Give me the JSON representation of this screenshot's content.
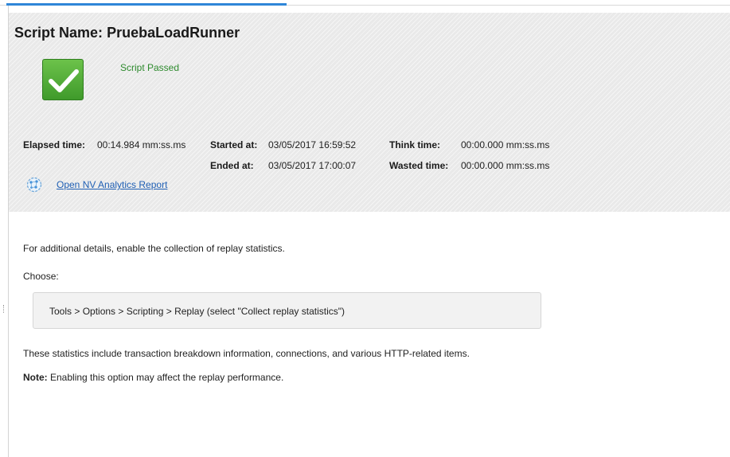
{
  "header": {
    "script_name_label": "Script Name:",
    "script_name_value": "PruebaLoadRunner",
    "status_text": "Script Passed",
    "status_color": "#2e8b2e",
    "status_icon": "check-icon"
  },
  "stats": {
    "elapsed_label": "Elapsed time:",
    "elapsed_value": "00:14.984 mm:ss.ms",
    "started_label": "Started at:",
    "started_value": "03/05/2017 16:59:52",
    "ended_label": "Ended at:",
    "ended_value": "03/05/2017 17:00:07",
    "think_label": "Think time:",
    "think_value": "00:00.000 mm:ss.ms",
    "wasted_label": "Wasted time:",
    "wasted_value": "00:00.000 mm:ss.ms"
  },
  "nv_link": {
    "label": "Open NV Analytics Report",
    "icon": "network-globe-icon"
  },
  "details": {
    "intro": "For additional details, enable the collection of replay statistics.",
    "choose": "Choose:",
    "path": "Tools > Options > Scripting > Replay (select \"Collect replay statistics\")",
    "info": "These statistics include transaction breakdown information, connections, and various HTTP-related items.",
    "note_label": "Note:",
    "note_text": " Enabling this option may affect the replay performance."
  },
  "colors": {
    "accent": "#2f86d8",
    "link": "#1f5fb4",
    "pass_green": "#4caf32"
  }
}
